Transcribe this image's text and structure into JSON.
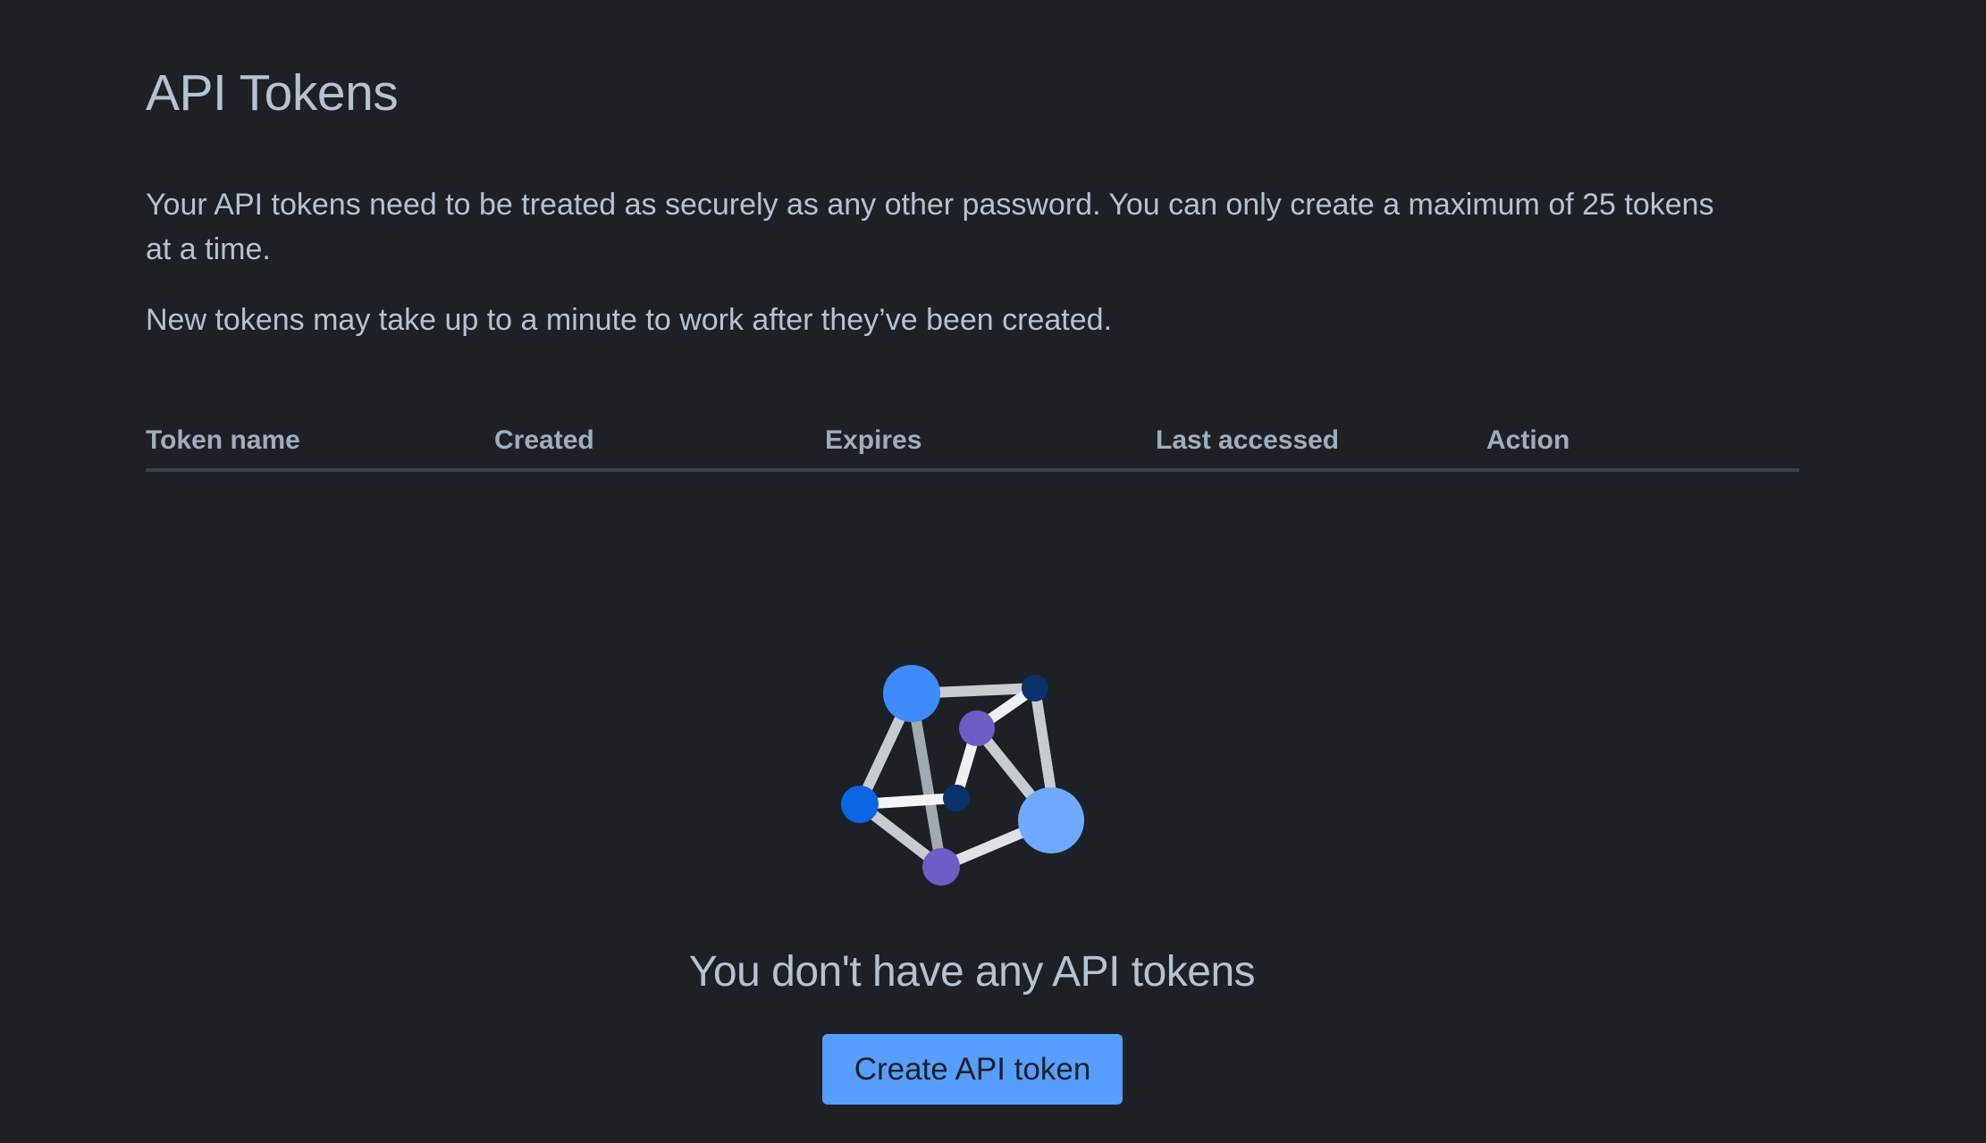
{
  "page": {
    "title": "API Tokens",
    "description": "Your API tokens need to be treated as securely as any other password. You can only create a maximum of 25 tokens at a time.",
    "note": "New tokens may take up to a minute to work after they’ve been created."
  },
  "table": {
    "columns": [
      "Token name",
      "Created",
      "Expires",
      "Last accessed",
      "Action"
    ],
    "rows": []
  },
  "empty_state": {
    "illustration_icon": "network-graph-illustration",
    "title": "You don't have any API tokens",
    "button_label": "Create API token"
  },
  "colors": {
    "background": "#1d2125",
    "text": "#b6c2cf",
    "header_text": "#9fadbc",
    "divider": "#38414a",
    "button": "#579dff",
    "accent_blue": "#0c66e4",
    "accent_light_blue": "#579dff",
    "accent_purple": "#6e5dc6",
    "accent_navy": "#09326c"
  }
}
